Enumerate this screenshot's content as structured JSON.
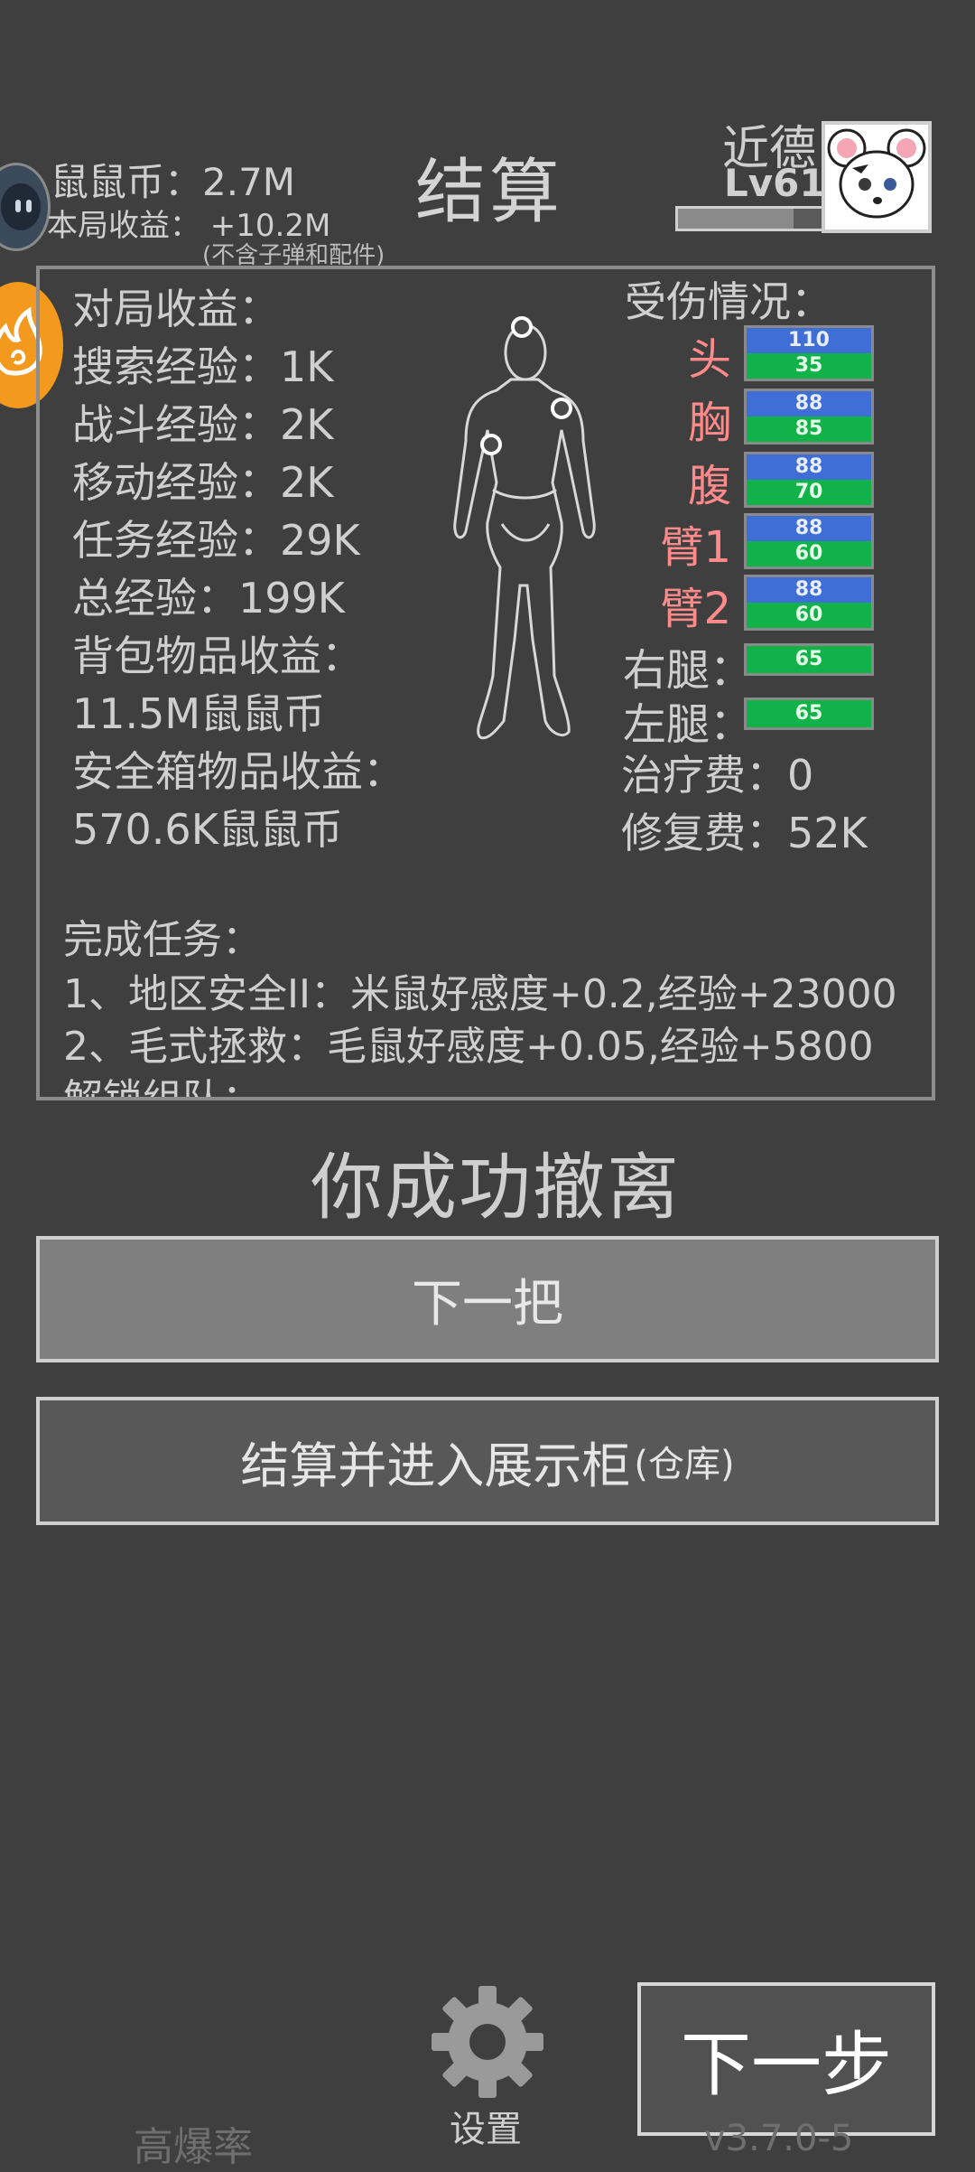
{
  "header": {
    "coins_label": "鼠鼠币：2.7M",
    "round_earn_label": "本局收益： +10.2M",
    "round_earn_note": "(不含子弹和配件)",
    "title": "结算",
    "player_name": "近德",
    "player_level": "Lv61"
  },
  "stats": {
    "section_title": "对局收益：",
    "search_exp": "搜索经验：1K",
    "combat_exp": "战斗经验：2K",
    "move_exp": "移动经验：2K",
    "quest_exp": "任务经验：29K",
    "total_exp": "总经验：199K",
    "backpack_label": "背包物品收益：",
    "backpack_value": "11.5M鼠鼠币",
    "safebox_label": "安全箱物品收益：",
    "safebox_value": "570.6K鼠鼠币"
  },
  "damage": {
    "title": "受伤情况：",
    "parts": [
      {
        "name": "头",
        "armor": "110",
        "health": "35"
      },
      {
        "name": "胸",
        "armor": "88",
        "health": "85"
      },
      {
        "name": "腹",
        "armor": "88",
        "health": "70"
      },
      {
        "name": "臂1",
        "armor": "88",
        "health": "60"
      },
      {
        "name": "臂2",
        "armor": "88",
        "health": "60"
      }
    ],
    "legs": [
      {
        "name": "右腿：",
        "health": "65"
      },
      {
        "name": "左腿：",
        "health": "65"
      }
    ],
    "heal_fee": "治疗费：0",
    "repair_fee": "修复费：52K"
  },
  "tasks": {
    "title": "完成任务：",
    "items": [
      "1、地区安全II：米鼠好感度+0.2,经验+23000",
      "2、毛式拯救：毛鼠好感度+0.05,经验+5800"
    ],
    "partial_line": "解锁组队："
  },
  "escape_text": "你成功撤离",
  "buttons": {
    "next_round": "下一把",
    "settle_main": "结算并进入展示柜",
    "settle_sub": "(仓库)",
    "next_step": "下一步"
  },
  "footer": {
    "high_rate": "高爆率",
    "settings": "设置",
    "version": "v3.7.0-5"
  },
  "colors": {
    "background": "#3f3f3f",
    "damaged_part": "#ff8a8a",
    "armor_bar": "#3f6fd6",
    "health_bar": "#12b24a",
    "accent_orange": "#f39a1e"
  }
}
